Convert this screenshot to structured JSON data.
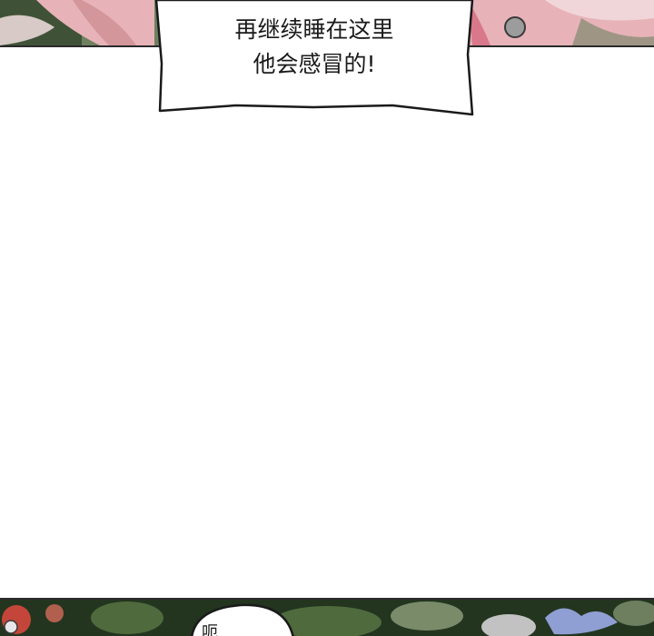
{
  "panels": {
    "top": {
      "colors": {
        "foliage_dark": "#3f5238",
        "foliage_mid": "#6f8060",
        "skin_pink": "#e7b3b8",
        "hair_pink": "#d9788a",
        "light_haze": "#f2dfe0",
        "stone_gray": "#9c9c9c"
      }
    },
    "bottom": {
      "colors": {
        "foliage_dark": "#23351f",
        "foliage_mid": "#4f6a3d",
        "leaf_light": "#9fb08a",
        "flower_red": "#c4463a",
        "flower_white": "#e8e6ea",
        "petal_blue": "#8f9ed3"
      }
    }
  },
  "speech_bubble_top": {
    "line1": "再继续睡在这里",
    "line2": "他会感冒的!"
  },
  "speech_bubble_bottom": {
    "partial_text": "呃"
  }
}
